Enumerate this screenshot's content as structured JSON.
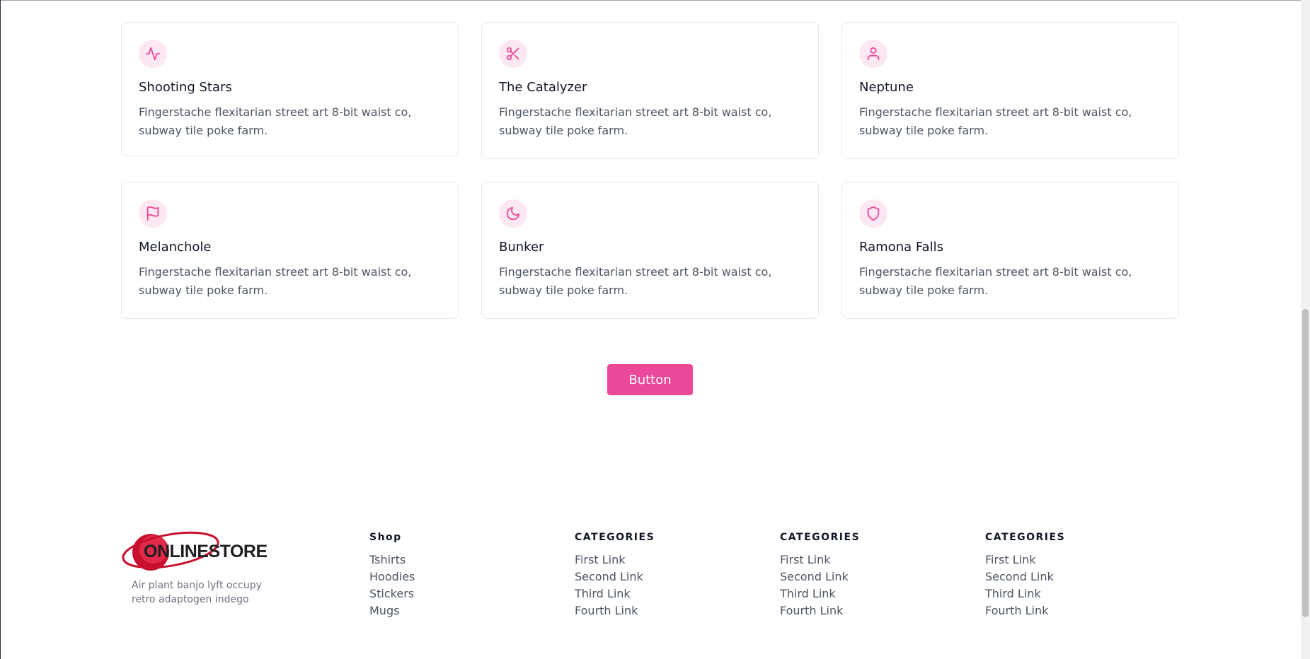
{
  "features": [
    {
      "icon": "pulse-icon",
      "title": "Shooting Stars",
      "text": "Fingerstache flexitarian street art 8-bit waist co, subway tile poke farm."
    },
    {
      "icon": "scissors-icon",
      "title": "The Catalyzer",
      "text": "Fingerstache flexitarian street art 8-bit waist co, subway tile poke farm."
    },
    {
      "icon": "user-icon",
      "title": "Neptune",
      "text": "Fingerstache flexitarian street art 8-bit waist co, subway tile poke farm."
    },
    {
      "icon": "flag-icon",
      "title": "Melanchole",
      "text": "Fingerstache flexitarian street art 8-bit waist co, subway tile poke farm."
    },
    {
      "icon": "moon-icon",
      "title": "Bunker",
      "text": "Fingerstache flexitarian street art 8-bit waist co, subway tile poke farm."
    },
    {
      "icon": "shield-icon",
      "title": "Ramona Falls",
      "text": "Fingerstache flexitarian street art 8-bit waist co, subway tile poke farm."
    }
  ],
  "cta": {
    "label": "Button"
  },
  "footer": {
    "logo_text": "ONLINESTORE",
    "tagline": "Air plant banjo lyft occupy retro adaptogen indego",
    "columns": [
      {
        "heading": "Shop",
        "links": [
          "Tshirts",
          "Hoodies",
          "Stickers",
          "Mugs"
        ]
      },
      {
        "heading": "CATEGORIES",
        "links": [
          "First Link",
          "Second Link",
          "Third Link",
          "Fourth Link"
        ]
      },
      {
        "heading": "CATEGORIES",
        "links": [
          "First Link",
          "Second Link",
          "Third Link",
          "Fourth Link"
        ]
      },
      {
        "heading": "CATEGORIES",
        "links": [
          "First Link",
          "Second Link",
          "Third Link",
          "Fourth Link"
        ]
      }
    ]
  },
  "colors": {
    "accent": "#ec4899",
    "accent_soft": "#fce7f3",
    "logo_red": "#c8102e"
  }
}
